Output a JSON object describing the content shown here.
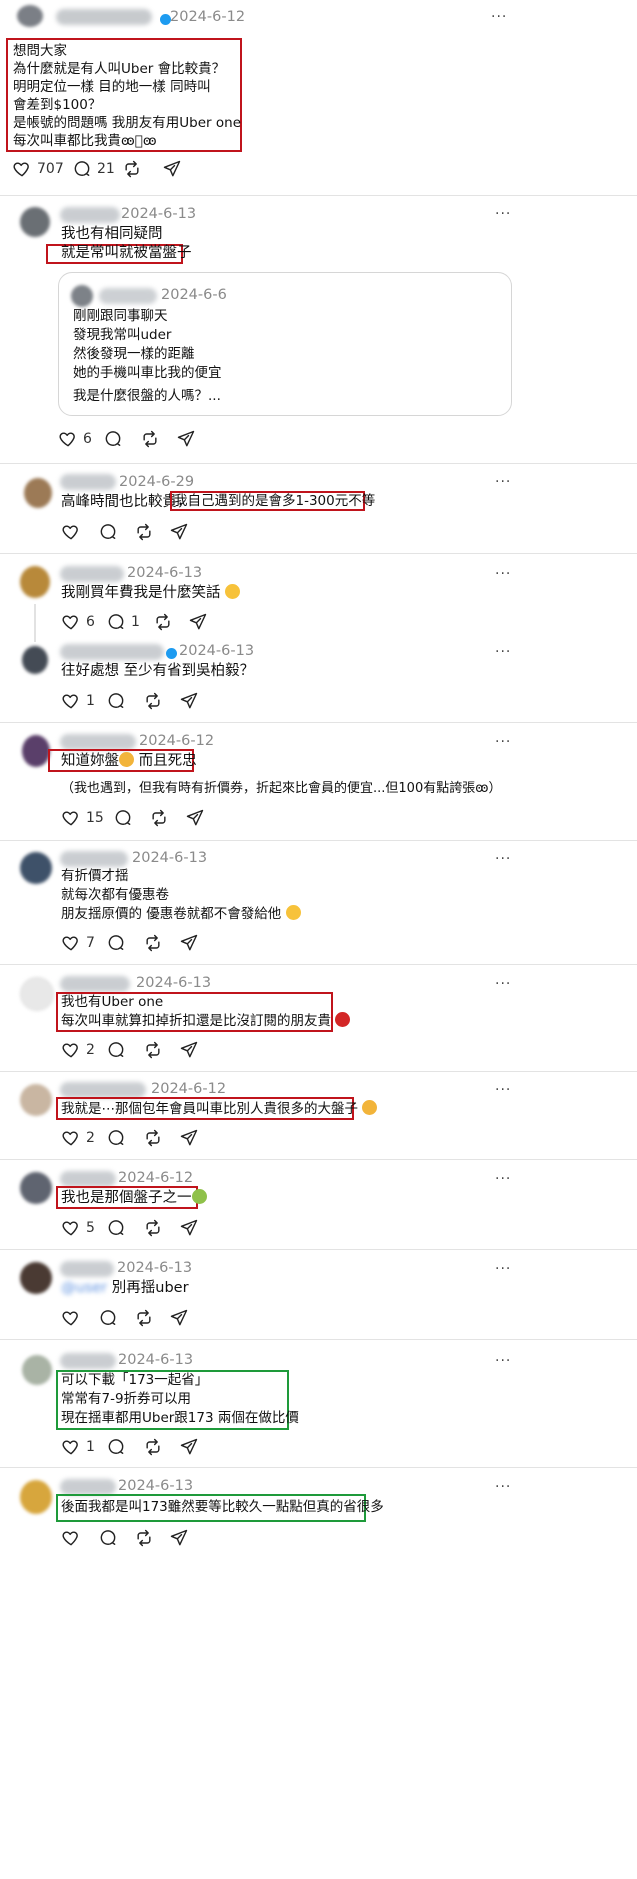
{
  "posts": [
    {
      "date": "2024-6-12",
      "text": "想問大家\n為什麼就是有人叫Uber 會比較貴？\n明明定位一樣 目的地一樣 同時叫\n會差到$100？\n是帳號的問題嗎 我朋友有用Uber one\n每次叫車都比我貴ꙭ⃝ꙭ",
      "likes": "707",
      "comments": "21"
    },
    {
      "date": "2024-6-13",
      "line1": "我也有相同疑問",
      "line2": "就是常叫就被當盤子",
      "quote": {
        "date": "2024-6-6",
        "text": "剛剛跟同事聊天\n發現我常叫uder\n然後發現一樣的距離\n她的手機叫車比我的便宜",
        "text2": "我是什麼很盤的人嗎？..."
      },
      "likes": "6"
    },
    {
      "date": "2024-6-29",
      "text_plain": "高峰時間也比較貴，",
      "text_hl": "我自己遇到的是會多1-300元不等"
    },
    {
      "date": "2024-6-13",
      "text": "我剛買年費我是什麼笑話",
      "likes": "6",
      "comments": "1"
    },
    {
      "date": "2024-6-13",
      "text": "往好處想 至少有省到吳柏毅？",
      "likes": "1"
    },
    {
      "date": "2024-6-12",
      "text_hl": "知道妳盤",
      "text_hl2": " 而且死忠",
      "text2": "（我也遇到，但我有時有折價券，折起來比會員的便宜...但100有點誇張ꙭ）",
      "likes": "15"
    },
    {
      "date": "2024-6-13",
      "text": "有折價才揺\n就每次都有優惠卷\n朋友揺原價的 優惠卷就都不會發給他",
      "likes": "7"
    },
    {
      "date": "2024-6-13",
      "text": "我也有Uber one\n每次叫車就算扣掉折扣還是比沒訂閱的朋友貴",
      "likes": "2"
    },
    {
      "date": "2024-6-12",
      "text": "我就是⋯那個包年會員叫車比別人貴很多的大盤子",
      "likes": "2"
    },
    {
      "date": "2024-6-12",
      "text": "我也是那個盤子之一",
      "likes": "5"
    },
    {
      "date": "2024-6-13",
      "mention": "@user",
      "text": "別再揺uber"
    },
    {
      "date": "2024-6-13",
      "text": "可以下載「173一起省」\n常常有7-9折券可以用\n現在揺車都用Uber跟173 兩個在做比價",
      "likes": "1"
    },
    {
      "date": "2024-6-13",
      "text": "後面我都是叫173雖然要等比較久一點點但真的省很多"
    }
  ],
  "colors": {
    "highlight_red": "#c0141c",
    "highlight_green": "#1e9a3a",
    "verified": "#1d9bf0"
  },
  "icons": [
    "heart-icon",
    "comment-icon",
    "repost-icon",
    "share-icon",
    "more-icon",
    "verified-icon"
  ]
}
